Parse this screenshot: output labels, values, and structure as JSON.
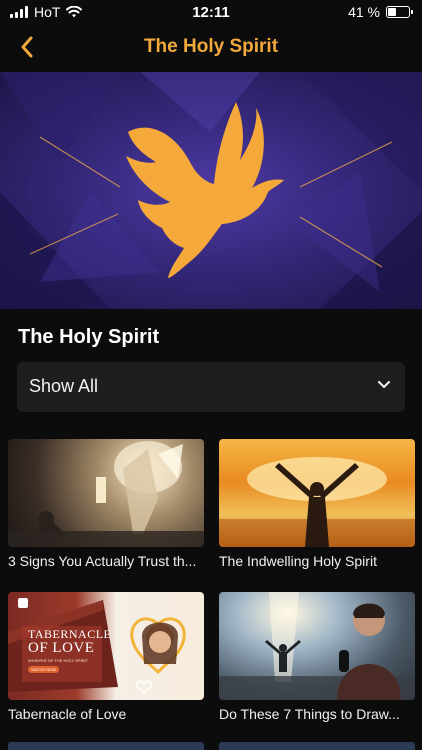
{
  "status_bar": {
    "carrier": "HoT",
    "time": "12:11",
    "battery": "41 %",
    "battery_level": 0.41
  },
  "nav": {
    "title": "The Holy Spirit",
    "back_icon": "chevron-left-icon"
  },
  "section": {
    "title": "The Holy Spirit"
  },
  "filter": {
    "selected": "Show All",
    "icon": "chevron-down-icon"
  },
  "videos": [
    {
      "title": "3 Signs You Actually Trust th..."
    },
    {
      "title": "The Indwelling Holy Spirit"
    },
    {
      "title": "Tabernacle of Love",
      "thumb_text": {
        "line1": "TABERNACLE",
        "line2": "OF LOVE",
        "sub": "WHISPER OF THE HOLY SPIRIT",
        "cta": "WATCH NOW"
      }
    },
    {
      "title": "Do These 7 Things to Draw..."
    }
  ],
  "colors": {
    "accent": "#f2a93b",
    "background": "#0c0c0d",
    "hero": "#35287a",
    "dropdown": "#1e1e20"
  }
}
